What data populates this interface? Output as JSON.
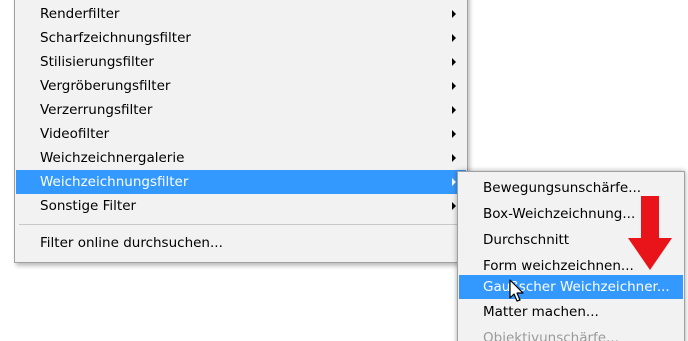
{
  "main_menu": {
    "items": [
      {
        "label": "Renderfilter",
        "submenu": true
      },
      {
        "label": "Scharfzeichnungsfilter",
        "submenu": true
      },
      {
        "label": "Stilisierungsfilter",
        "submenu": true
      },
      {
        "label": "Vergröberungsfilter",
        "submenu": true
      },
      {
        "label": "Verzerrungsfilter",
        "submenu": true
      },
      {
        "label": "Videofilter",
        "submenu": true
      },
      {
        "label": "Weichzeichnergalerie",
        "submenu": true
      },
      {
        "label": "Weichzeichnungsfilter",
        "submenu": true,
        "highlighted": true
      },
      {
        "label": "Sonstige Filter",
        "submenu": true
      }
    ],
    "search_online": "Filter online durchsuchen..."
  },
  "sub_menu": {
    "items": [
      {
        "label": "Bewegungsunschärfe..."
      },
      {
        "label": "Box-Weichzeichnung..."
      },
      {
        "label": "Durchschnitt"
      },
      {
        "label": "Form weichzeichnen..."
      },
      {
        "label": "Gaußscher Weichzeichner...",
        "highlighted": true
      },
      {
        "label": "Matter machen..."
      },
      {
        "label": "Objektivunschärfe...",
        "disabled": true
      }
    ]
  },
  "colors": {
    "highlight": "#3399ff",
    "menu_background": "#f2f2f2",
    "annotation_arrow": "#e8141a"
  },
  "icons": {
    "pointer": "mouse-cursor-icon",
    "annotation": "red-down-arrow-icon"
  }
}
